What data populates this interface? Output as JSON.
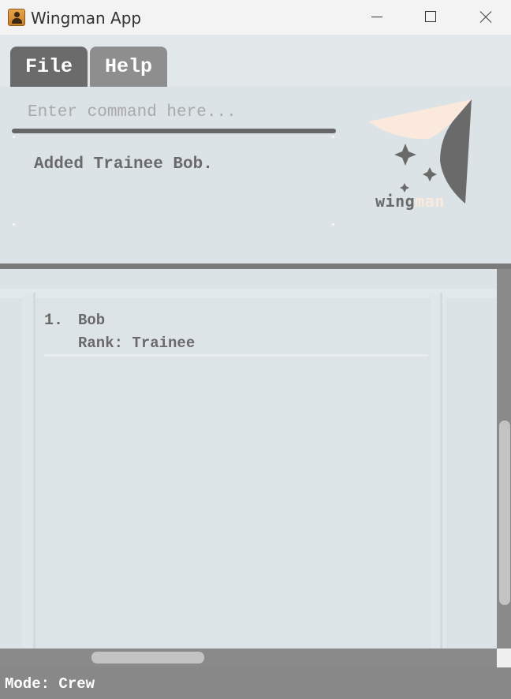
{
  "window": {
    "title": "Wingman App",
    "controls": [
      "minimize",
      "maximize",
      "close"
    ]
  },
  "menu": {
    "items": [
      {
        "label": "File"
      },
      {
        "label": "Help"
      }
    ]
  },
  "command": {
    "placeholder": "Enter command here...",
    "value": ""
  },
  "result": {
    "message": "Added Trainee Bob."
  },
  "logo": {
    "text_part1": "wing",
    "text_part2": "man"
  },
  "list": {
    "items": [
      {
        "index": "1.",
        "name": "Bob",
        "rank": "Rank: Trainee"
      }
    ]
  },
  "status": {
    "mode": "Mode: Crew"
  },
  "colors": {
    "menu_active": "#6b6b6b",
    "menu_inactive": "#8e8e8e",
    "background": "#dbe3e6",
    "status_bar": "#888888",
    "logo_peach": "#fbe9dd",
    "logo_gray": "#6a6a6a"
  },
  "icons": {
    "app": "app-person-icon",
    "logo_shape": "wingman-logo-icon",
    "logo_star": "sparkle-icon"
  }
}
